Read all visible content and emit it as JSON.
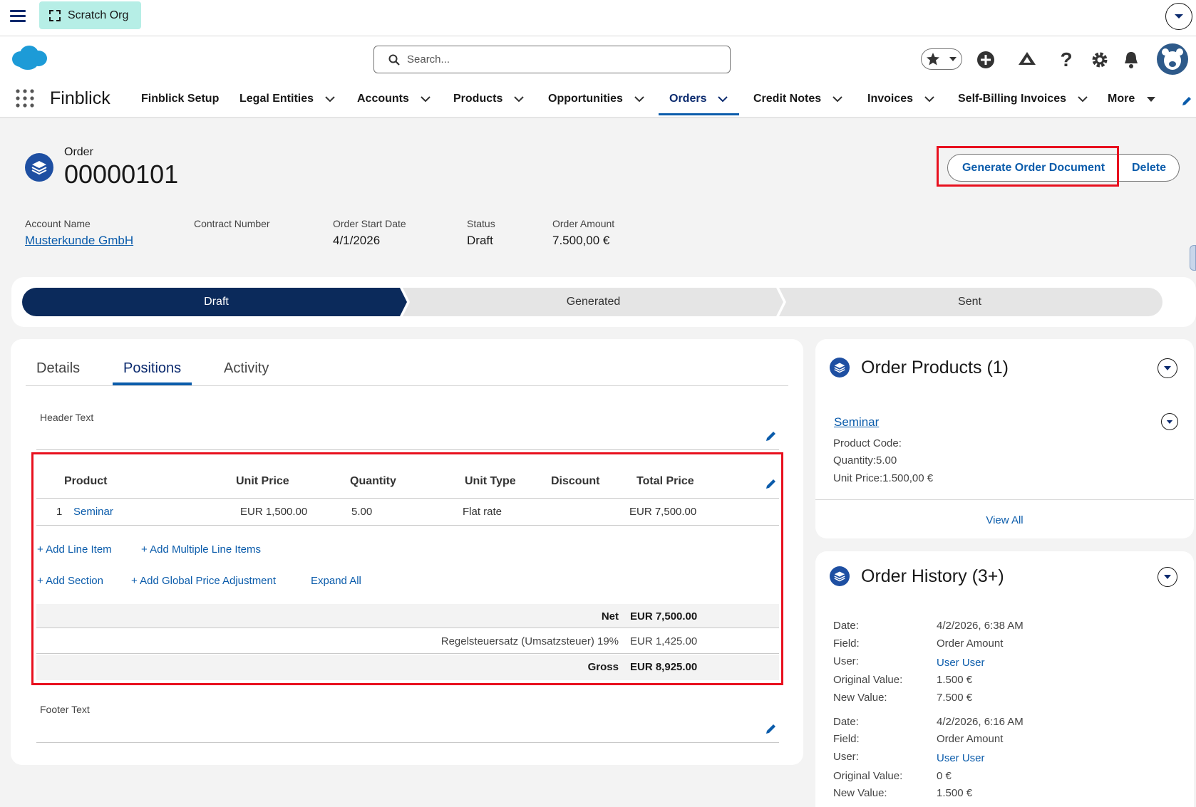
{
  "topbar": {
    "org_label": "Scratch Org"
  },
  "header": {
    "search_placeholder": "Search..."
  },
  "nav": {
    "app_name": "Finblick",
    "items": [
      {
        "label": "Finblick Setup"
      },
      {
        "label": "Legal Entities"
      },
      {
        "label": "Accounts"
      },
      {
        "label": "Products"
      },
      {
        "label": "Opportunities"
      },
      {
        "label": "Orders"
      },
      {
        "label": "Credit Notes"
      },
      {
        "label": "Invoices"
      },
      {
        "label": "Self-Billing Invoices"
      },
      {
        "label": "More"
      }
    ]
  },
  "record": {
    "object_label": "Order",
    "title": "00000101",
    "actions": {
      "generate": "Generate Order Document",
      "delete": "Delete"
    },
    "fields": [
      {
        "label": "Account Name",
        "value": "Musterkunde GmbH"
      },
      {
        "label": "Contract Number",
        "value": ""
      },
      {
        "label": "Order Start Date",
        "value": "4/1/2026"
      },
      {
        "label": "Status",
        "value": "Draft"
      },
      {
        "label": "Order Amount",
        "value": "7.500,00 €"
      }
    ]
  },
  "path": {
    "stages": [
      "Draft",
      "Generated",
      "Sent"
    ],
    "current": "Draft"
  },
  "tabs": {
    "items": [
      "Details",
      "Positions",
      "Activity"
    ],
    "active": "Positions"
  },
  "positions": {
    "header_text_label": "Header Text",
    "footer_text_label": "Footer Text",
    "columns": [
      "Product",
      "Unit Price",
      "Quantity",
      "Unit Type",
      "Discount",
      "Total Price"
    ],
    "rows": [
      {
        "num": "1",
        "product": "Seminar",
        "unit_price": "EUR 1,500.00",
        "quantity": "5.00",
        "unit_type": "Flat rate",
        "discount": "",
        "total": "EUR 7,500.00"
      }
    ],
    "actions": {
      "add_line_item": "+ Add Line Item",
      "add_multiple": "+ Add Multiple Line Items",
      "add_section": "+ Add Section",
      "add_global": "+ Add Global Price Adjustment",
      "expand_all": "Expand All"
    },
    "summary": {
      "net_label": "Net",
      "net_value": "EUR 7,500.00",
      "tax_label": "Regelsteuersatz (Umsatzsteuer) 19%",
      "tax_value": "EUR 1,425.00",
      "gross_label": "Gross",
      "gross_value": "EUR 8,925.00"
    }
  },
  "order_products": {
    "title": "Order Products (1)",
    "item": {
      "name": "Seminar",
      "product_code": "Product Code:",
      "quantity": "Quantity:5.00",
      "unit_price": "Unit Price:1.500,00 €"
    },
    "view_all": "View All"
  },
  "order_history": {
    "title": "Order History (3+)",
    "labels": {
      "date": "Date:",
      "field": "Field:",
      "user": "User:",
      "orig": "Original Value:",
      "new": "New Value:"
    },
    "entries": [
      {
        "date": "4/2/2026, 6:38 AM",
        "field": "Order Amount",
        "user": "User User",
        "orig": "1.500 €",
        "new": "7.500 €"
      },
      {
        "date": "4/2/2026, 6:16 AM",
        "field": "Order Amount",
        "user": "User User",
        "orig": "0 €",
        "new": "1.500 €"
      }
    ]
  }
}
